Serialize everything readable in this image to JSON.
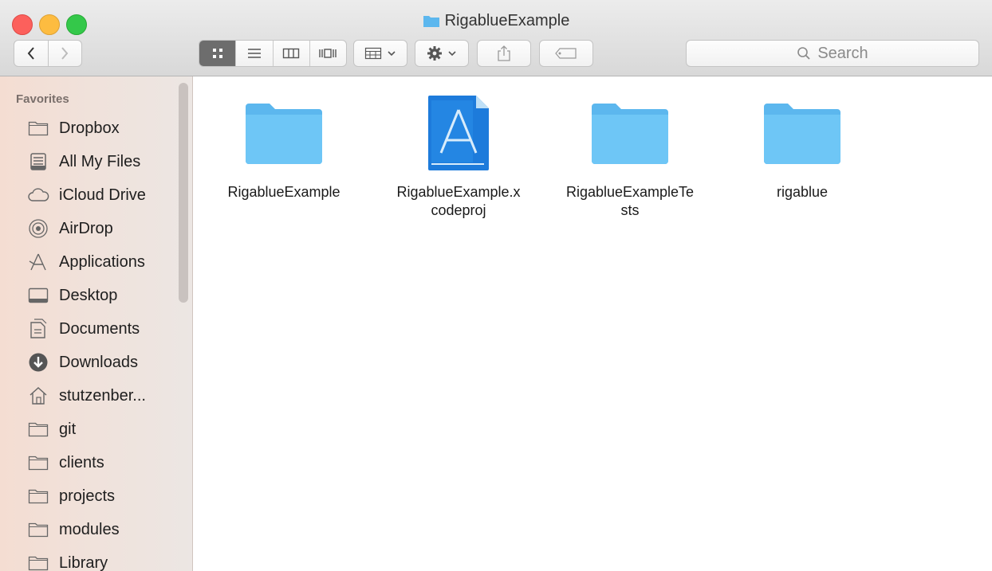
{
  "window": {
    "title": "RigablueExample"
  },
  "toolbar": {
    "search_placeholder": "Search"
  },
  "sidebar": {
    "heading": "Favorites",
    "items": [
      {
        "label": "Dropbox",
        "icon": "folder-icon"
      },
      {
        "label": "All My Files",
        "icon": "all-files-icon"
      },
      {
        "label": "iCloud Drive",
        "icon": "cloud-icon"
      },
      {
        "label": "AirDrop",
        "icon": "airdrop-icon"
      },
      {
        "label": "Applications",
        "icon": "applications-icon"
      },
      {
        "label": "Desktop",
        "icon": "desktop-icon"
      },
      {
        "label": "Documents",
        "icon": "documents-icon"
      },
      {
        "label": "Downloads",
        "icon": "downloads-icon"
      },
      {
        "label": "stutzenber...",
        "icon": "home-icon"
      },
      {
        "label": "git",
        "icon": "folder-icon"
      },
      {
        "label": "clients",
        "icon": "folder-icon"
      },
      {
        "label": "projects",
        "icon": "folder-icon"
      },
      {
        "label": "modules",
        "icon": "folder-icon"
      },
      {
        "label": "Library",
        "icon": "folder-icon"
      }
    ]
  },
  "files": [
    {
      "line1": "RigablueExample",
      "line2": "",
      "icon": "folder-icon"
    },
    {
      "line1": "RigablueExample.x",
      "line2": "codeproj",
      "icon": "xcode-project-icon"
    },
    {
      "line1": "RigablueExampleTe",
      "line2": "sts",
      "icon": "folder-icon"
    },
    {
      "line1": "rigablue",
      "line2": "",
      "icon": "folder-icon"
    }
  ],
  "colors": {
    "folder_blue": "#5cb7ee",
    "close": "#fc605c",
    "minimize": "#fdbc40",
    "zoom": "#34c84a"
  }
}
